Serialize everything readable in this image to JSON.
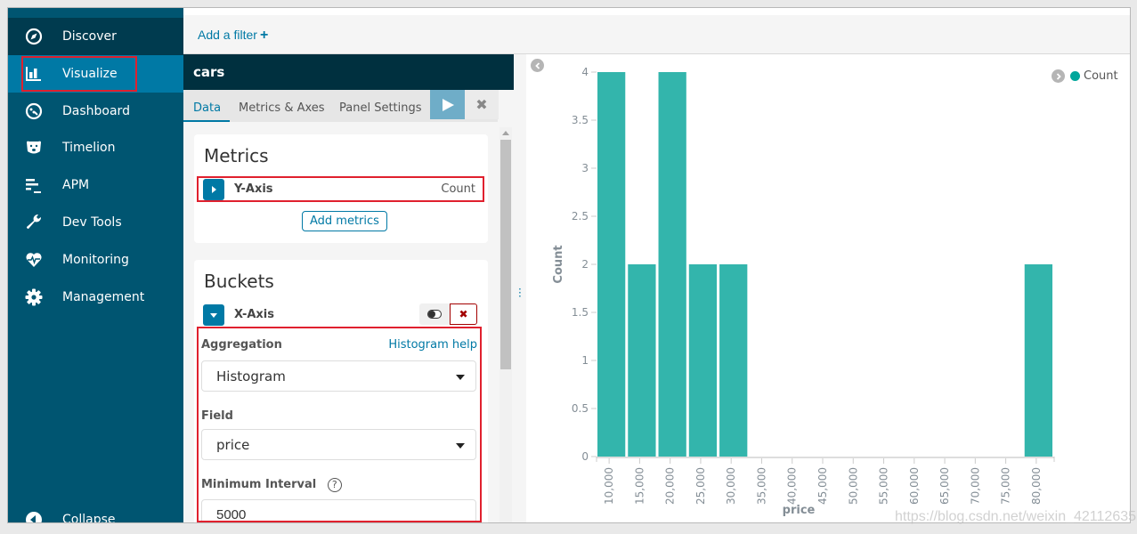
{
  "sidebar": {
    "items": [
      {
        "label": "Discover",
        "icon": "compass-icon"
      },
      {
        "label": "Visualize",
        "icon": "bar-chart-icon",
        "active": true
      },
      {
        "label": "Dashboard",
        "icon": "dashboard-gauge-icon"
      },
      {
        "label": "Timelion",
        "icon": "bear-face-icon"
      },
      {
        "label": "APM",
        "icon": "apm-bars-icon"
      },
      {
        "label": "Dev Tools",
        "icon": "wrench-icon"
      },
      {
        "label": "Monitoring",
        "icon": "heartbeat-icon"
      },
      {
        "label": "Management",
        "icon": "gear-icon"
      }
    ],
    "collapse_label": "Collapse"
  },
  "filterbar": {
    "add_filter_label": "Add a filter",
    "add_icon": "+"
  },
  "editor": {
    "title": "cars",
    "tabs": [
      {
        "label": "Data",
        "active": true
      },
      {
        "label": "Metrics & Axes",
        "active": false
      },
      {
        "label": "Panel Settings",
        "active": false
      }
    ],
    "metrics": {
      "heading": "Metrics",
      "items": [
        {
          "axis": "Y-Axis",
          "agg": "Count"
        }
      ],
      "add_label": "Add metrics"
    },
    "buckets": {
      "heading": "Buckets",
      "items": [
        {
          "axis": "X-Axis"
        }
      ],
      "aggregation_label": "Aggregation",
      "help_link": "Histogram help",
      "aggregation_value": "Histogram",
      "field_label": "Field",
      "field_value": "price",
      "interval_label": "Minimum Interval",
      "interval_value": "5000"
    }
  },
  "colors": {
    "bar": "#33b5ac",
    "accent": "#0079a5",
    "sidebar": "#005571",
    "highlight": "#e0202e"
  },
  "chart_data": {
    "type": "bar",
    "title": "",
    "xlabel": "price",
    "ylabel": "Count",
    "x": [
      10000,
      15000,
      20000,
      25000,
      30000,
      35000,
      40000,
      45000,
      50000,
      55000,
      60000,
      65000,
      70000,
      75000,
      80000
    ],
    "tick_labels": [
      "10,000",
      "15,000",
      "20,000",
      "25,000",
      "30,000",
      "35,000",
      "40,000",
      "45,000",
      "50,000",
      "55,000",
      "60,000",
      "65,000",
      "70,000",
      "75,000",
      "80,000"
    ],
    "series": [
      {
        "name": "Count",
        "values": [
          4,
          2,
          4,
          2,
          2,
          0,
          0,
          0,
          0,
          0,
          0,
          0,
          0,
          0,
          2
        ]
      }
    ],
    "y_ticks": [
      "0",
      "0.5",
      "1",
      "1.5",
      "2",
      "2.5",
      "3",
      "3.5",
      "4"
    ],
    "ylim": [
      0,
      4
    ],
    "legend": "top-right",
    "grid": false
  },
  "watermark": "https://blog.csdn.net/weixin_42112635"
}
